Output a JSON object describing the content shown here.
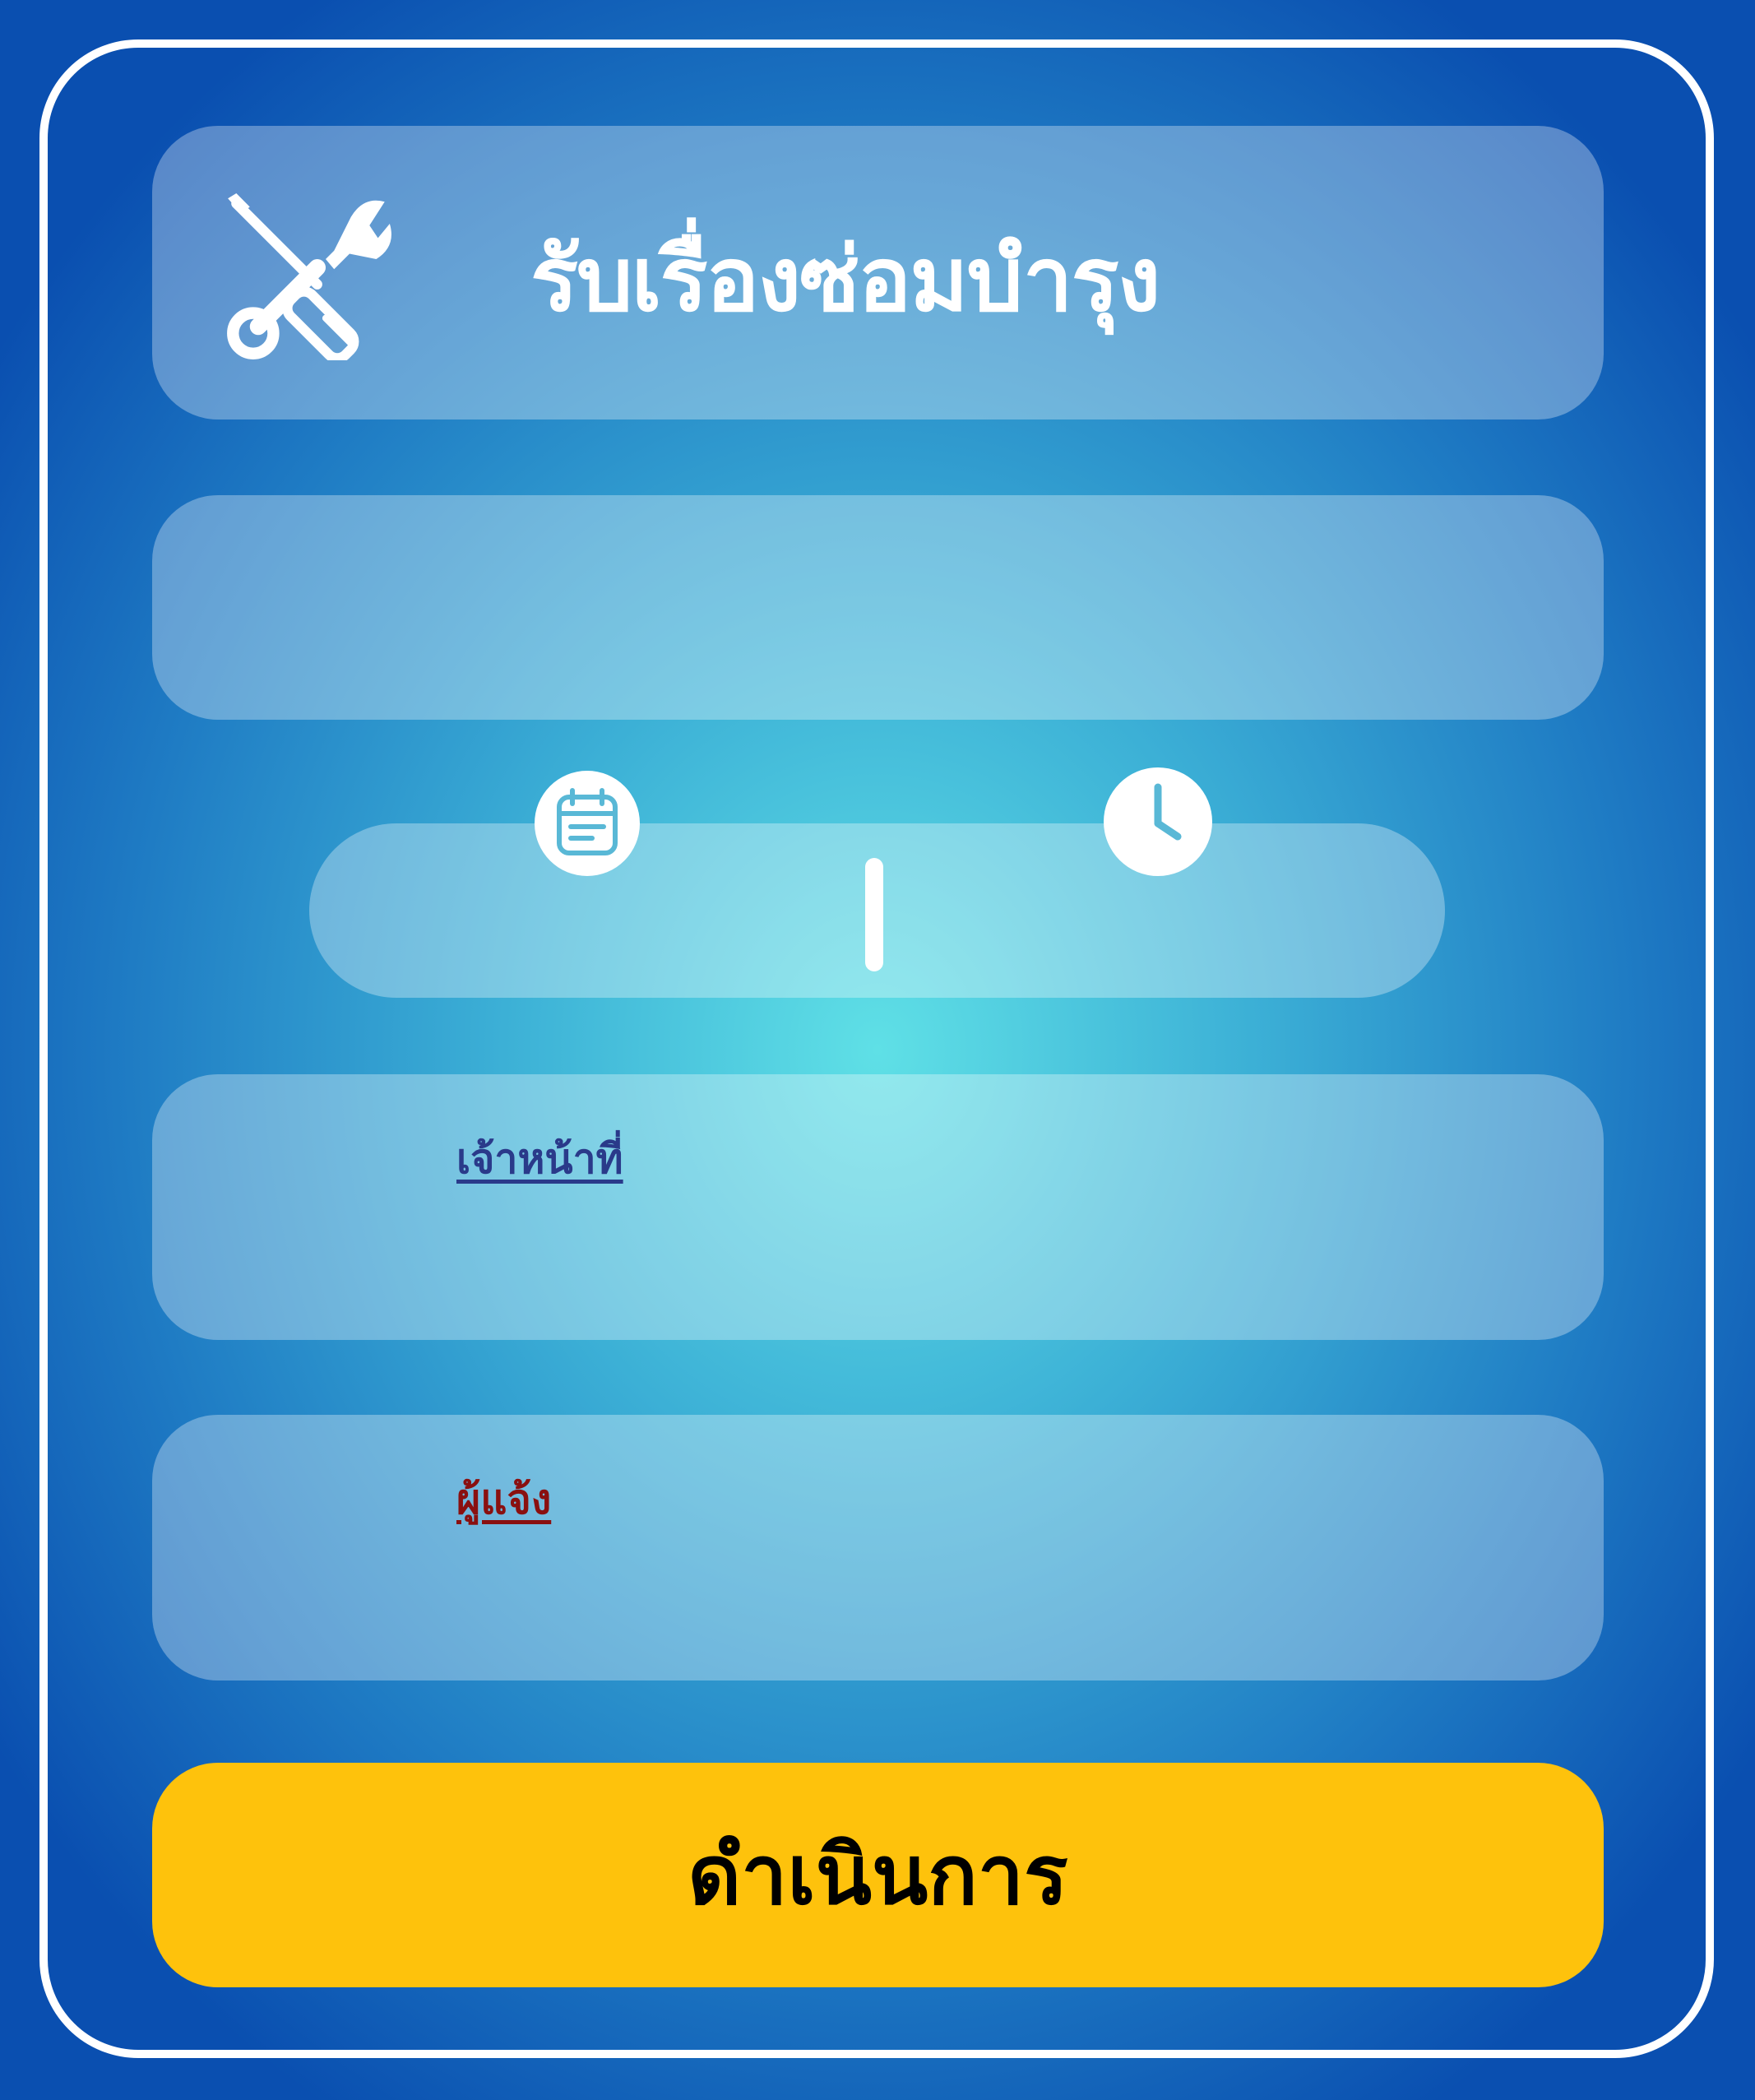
{
  "header": {
    "title": "รับเรื่องซ่อมบำรุง",
    "icon": "tools-icon"
  },
  "field1": {
    "value": ""
  },
  "datetime": {
    "date_icon": "calendar-icon",
    "time_icon": "clock-icon",
    "date_value": "",
    "time_value": ""
  },
  "officer": {
    "label": "เจ้าหน้าที่",
    "value": ""
  },
  "reporter": {
    "label": "ผู้แจ้ง",
    "value": ""
  },
  "submit": {
    "label": "ดำเนินการ"
  },
  "colors": {
    "accent": "#fec20c",
    "officer_label": "#2a3a8a",
    "reporter_label": "#8a1010",
    "panel": "#ffffff"
  }
}
